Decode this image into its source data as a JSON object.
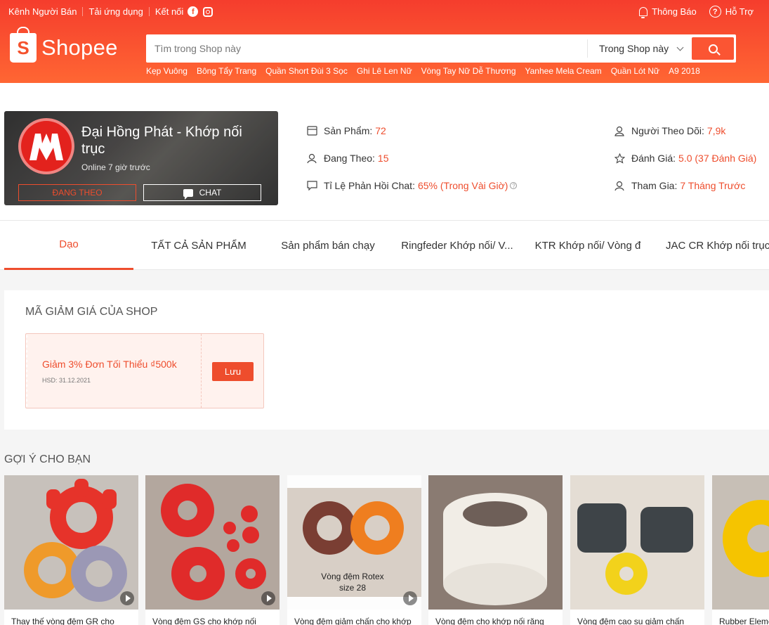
{
  "topbar": {
    "seller_channel": "Kênh Người Bán",
    "app_download": "Tải ứng dụng",
    "connect": "Kết nối",
    "notifications": "Thông Báo",
    "help": "Hỗ Trợ"
  },
  "brand": {
    "logo_letter": "S",
    "logo_text": "Shopee",
    "accent": "#ee4d2d",
    "header_gradient": [
      "#f53d2d",
      "#ff6633"
    ]
  },
  "search": {
    "placeholder": "Tìm trong Shop này",
    "scope": "Trong Shop này",
    "suggestions": [
      "Kẹp Vuông",
      "Bông Tẩy Trang",
      "Quần Short Đùi 3 Sọc",
      "Ghi Lê Len Nữ",
      "Vòng Tay Nữ Dễ Thương",
      "Yanhee Mela Cream",
      "Quần Lót Nữ",
      "A9 2018"
    ]
  },
  "shop": {
    "name": "Đại Hồng Phát - Khớp nối trục",
    "status": "Online 7 giờ trước",
    "follow_label": "ĐANG THEO",
    "chat_label": "CHAT",
    "stats": {
      "products_label": "Sản Phẩm:",
      "products_value": "72",
      "following_label": "Đang Theo:",
      "following_value": "15",
      "chat_rate_label": "Tỉ Lệ Phản Hồi Chat:",
      "chat_rate_value": "65% (Trong Vài Giờ)",
      "followers_label": "Người Theo Dõi:",
      "followers_value": "7,9k",
      "rating_label": "Đánh Giá:",
      "rating_value": "5.0 (37 Đánh Giá)",
      "joined_label": "Tham Gia:",
      "joined_value": "7 Tháng Trước"
    }
  },
  "tabs": [
    "Dạo",
    "TẤT CẢ SẢN PHẨM",
    "Sản phẩm bán chạy",
    "Ringfeder Khớp nối/ V...",
    "KTR Khớp nối/ Vòng đ",
    "JAC CR Khớp nối trục"
  ],
  "vouchers": {
    "title": "MÃ GIẢM GIÁ CỦA SHOP",
    "items": [
      {
        "text": "Giảm 3% Đơn Tối Thiểu ₫500k",
        "expiry": "HSD: 31.12.2021",
        "button": "Lưu"
      }
    ]
  },
  "suggestions": {
    "title": "GỢI Ý CHO BẠN",
    "products": [
      {
        "name": "Thay thế vòng đệm GR cho",
        "has_video": true
      },
      {
        "name": "Vòng đệm GS cho khớp nối",
        "has_video": true
      },
      {
        "name": "Vòng đệm giảm chấn cho khớp",
        "has_video": true,
        "image_caption": "Vòng đệm Rotex",
        "image_caption_2": "size 28"
      },
      {
        "name": "Vòng đệm cho khớp nối răng",
        "has_video": false
      },
      {
        "name": "Vòng đệm cao su giảm chấn",
        "has_video": false
      },
      {
        "name": "Rubber Element",
        "has_video": false
      }
    ]
  }
}
